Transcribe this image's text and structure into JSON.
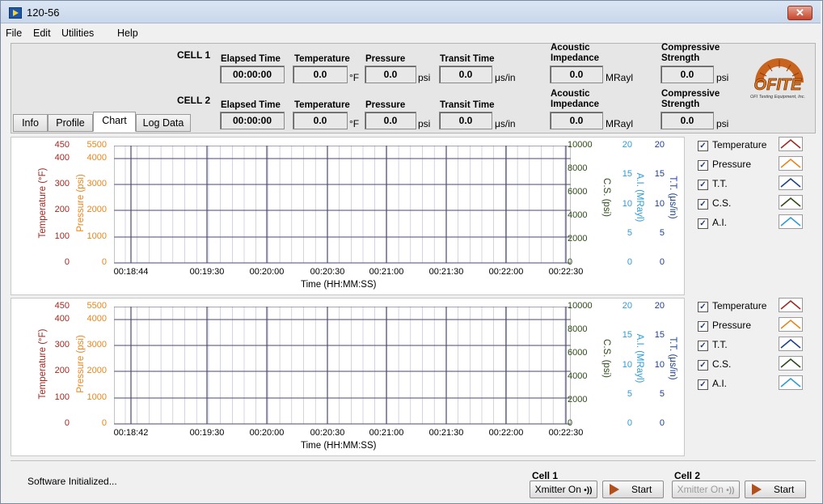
{
  "window": {
    "title": "120-56",
    "close_glyph": "✕"
  },
  "menu": [
    "File",
    "Edit",
    "Utilities",
    "Help"
  ],
  "fields": {
    "elapsed": "Elapsed Time",
    "temperature": "Temperature",
    "pressure": "Pressure",
    "transit": "Transit Time",
    "acoustic_1": "Acoustic",
    "acoustic_2": "Impedance",
    "comp_1": "Compressive",
    "comp_2": "Strength"
  },
  "units": {
    "temp": "°F",
    "pressure": "psi",
    "transit": "μs/in",
    "acoustic": "MRayl",
    "comp": "psi"
  },
  "cells": [
    {
      "label": "CELL 1",
      "elapsed": "00:00:00",
      "temperature": "0.0",
      "pressure": "0.0",
      "transit": "0.0",
      "acoustic": "0.0",
      "comp": "0.0"
    },
    {
      "label": "CELL 2",
      "elapsed": "00:00:00",
      "temperature": "0.0",
      "pressure": "0.0",
      "transit": "0.0",
      "acoustic": "0.0",
      "comp": "0.0"
    }
  ],
  "tabs": [
    {
      "label": "Info",
      "active": false
    },
    {
      "label": "Profile",
      "active": false
    },
    {
      "label": "Chart",
      "active": true
    },
    {
      "label": "Log Data",
      "active": false
    }
  ],
  "logo": {
    "text": "OFITE",
    "subtitle": "OFI Testing Equipment, Inc."
  },
  "colors": {
    "temperature": "#a02820",
    "pressure": "#e8861a",
    "tt": "#1c3f8e",
    "cs": "#2c4a14",
    "ai": "#2e9bd4",
    "grid": "#4a4a6e"
  },
  "axes": {
    "temp_title": "Temperature (°F)",
    "pressure_title": "Pressure (psi)",
    "cs_title": "C.S. (psi)",
    "ai_title": "A.I. (MRayl)",
    "tt_title": "T.T. (μs/in)",
    "x_title": "Time (HH:MM:SS)",
    "temp_ticks": [
      "450",
      "400",
      "300",
      "200",
      "100",
      "0"
    ],
    "pressure_ticks": [
      "5500",
      "4000",
      "3000",
      "2000",
      "1000",
      "0"
    ],
    "cs_ticks": [
      "10000",
      "8000",
      "6000",
      "4000",
      "2000",
      "0"
    ],
    "ai_ticks": [
      "20",
      "15",
      "10",
      "5",
      "0"
    ],
    "tt_ticks": [
      "20",
      "15",
      "10",
      "5",
      "0"
    ]
  },
  "charts": [
    {
      "x_ticks": [
        "00:18:44",
        "00:19:30",
        "00:20:00",
        "00:20:30",
        "00:21:00",
        "00:21:30",
        "00:22:00",
        "00:22:30"
      ]
    },
    {
      "x_ticks": [
        "00:18:42",
        "00:19:30",
        "00:20:00",
        "00:20:30",
        "00:21:00",
        "00:21:30",
        "00:22:00",
        "00:22:30"
      ]
    }
  ],
  "legend": [
    {
      "label": "Temperature",
      "checked": "✓",
      "color": "#a02820"
    },
    {
      "label": "Pressure",
      "checked": "✓",
      "color": "#e8861a"
    },
    {
      "label": "T.T.",
      "checked": "✓",
      "color": "#1c3f8e"
    },
    {
      "label": "C.S.",
      "checked": "✓",
      "color": "#2c4a14"
    },
    {
      "label": "A.I.",
      "checked": "✓",
      "color": "#2e9bd4"
    }
  ],
  "status": "Software Initialized...",
  "controls": [
    {
      "cell_label": "Cell 1",
      "xmitter": "Xmitter On",
      "xmitter_glyph": "•))",
      "start": "Start",
      "enabled": true
    },
    {
      "cell_label": "Cell 2",
      "xmitter": "Xmitter On",
      "xmitter_glyph": "•))",
      "start": "Start",
      "enabled": false
    }
  ]
}
